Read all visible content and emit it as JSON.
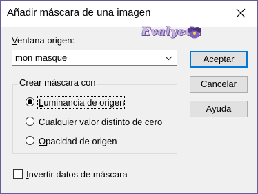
{
  "dialog": {
    "title": "Añadir máscara de una imagen",
    "watermark": "Evalyeda"
  },
  "source_window": {
    "label_mnemonic": "V",
    "label_rest": "entana origen:",
    "value": "mon masque"
  },
  "create_mask": {
    "group_label": "Crear máscara con",
    "options": [
      {
        "mnemonic": "L",
        "rest": "uminancia de origen",
        "selected": true
      },
      {
        "mnemonic": "C",
        "rest": "ualquier valor distinto de cero",
        "selected": false
      },
      {
        "mnemonic": "O",
        "rest": "pacidad de origen",
        "selected": false
      }
    ]
  },
  "invert": {
    "mnemonic": "I",
    "rest": "nvertir datos de máscara",
    "checked": false
  },
  "buttons": {
    "accept": "Aceptar",
    "cancel": "Cancelar",
    "help": "Ayuda"
  },
  "colors": {
    "window_border": "#6b5b9a",
    "focus_accent": "#0078d7"
  }
}
